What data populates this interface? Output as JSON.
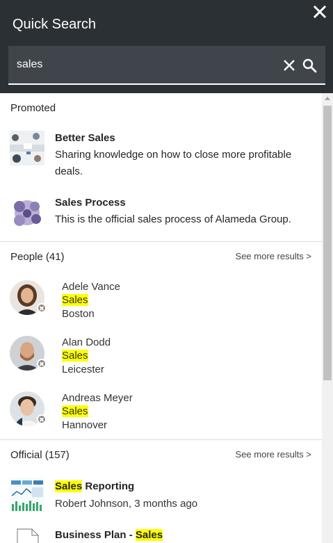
{
  "header": {
    "title": "Quick Search",
    "search_value": "sales",
    "close_icon": "close-icon",
    "clear_icon": "clear-icon",
    "search_icon": "search-icon"
  },
  "promoted": {
    "heading": "Promoted",
    "items": [
      {
        "title": "Better Sales",
        "description": "Sharing knowledge on how to close more profitable deals."
      },
      {
        "title": "Sales Process",
        "description": "This is the official sales process of Alameda Group."
      }
    ]
  },
  "people": {
    "heading": "People (41)",
    "see_more": "See more results >",
    "items": [
      {
        "name": "Adele Vance",
        "department": "Sales",
        "location": "Boston"
      },
      {
        "name": "Alan Dodd",
        "department": "Sales",
        "location": "Leicester"
      },
      {
        "name": "Andreas Meyer",
        "department": "Sales",
        "location": "Hannover"
      }
    ]
  },
  "official": {
    "heading": "Official (157)",
    "see_more": "See more results >",
    "items": [
      {
        "title_highlight": "Sales",
        "title_rest": " Reporting",
        "meta": "Robert Johnson, 3 months ago"
      },
      {
        "title_prefix": "Business Plan - ",
        "title_highlight": "Sales"
      }
    ]
  },
  "colors": {
    "header_bg": "#2b3035",
    "search_bg": "#3f454b",
    "highlight": "#ffff00"
  }
}
